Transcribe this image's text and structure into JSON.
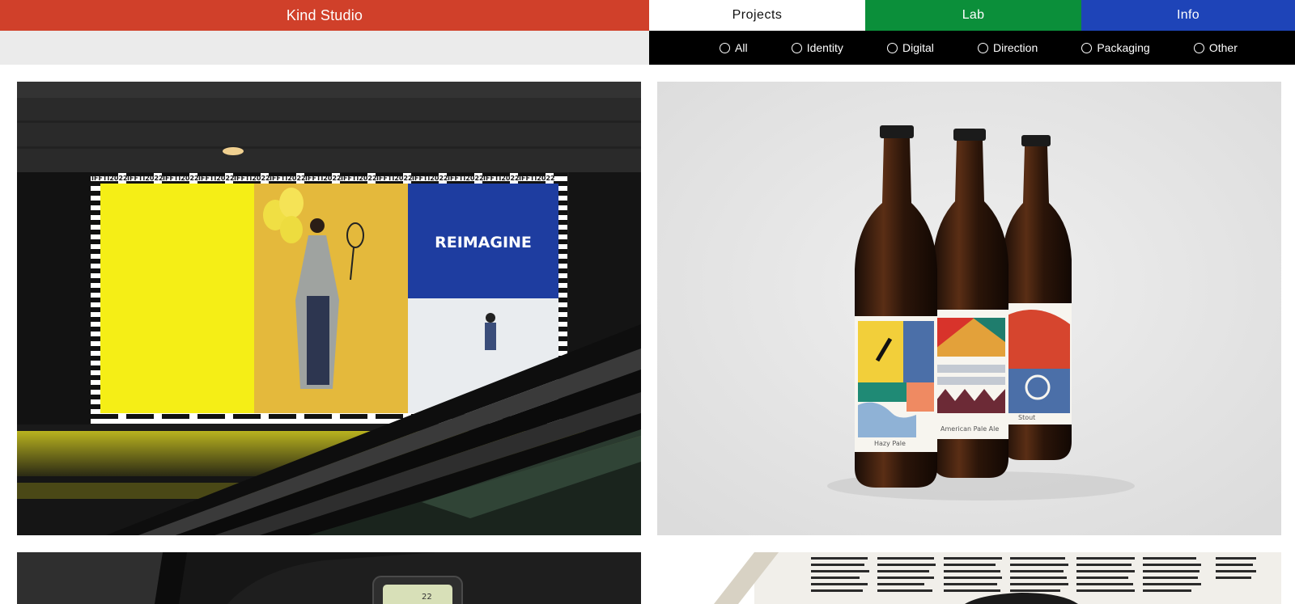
{
  "header": {
    "brand": "Kind Studio",
    "nav": [
      {
        "label": "Projects",
        "color": "#ffffff"
      },
      {
        "label": "Lab",
        "color": "#0b8f3a"
      },
      {
        "label": "Info",
        "color": "#1e44b8"
      }
    ],
    "brand_color": "#d0402a"
  },
  "filters": {
    "items": [
      {
        "label": "All"
      },
      {
        "label": "Identity"
      },
      {
        "label": "Digital"
      },
      {
        "label": "Direction"
      },
      {
        "label": "Packaging"
      },
      {
        "label": "Other"
      }
    ]
  },
  "projects": {
    "billboard": {
      "tag": "IFFTI2022",
      "headline": "REIMAGINE"
    },
    "bottles": {
      "labels": [
        "Hazy Pale",
        "American Pale Ale",
        "Stout"
      ]
    },
    "tablet": {
      "time": "22"
    }
  }
}
